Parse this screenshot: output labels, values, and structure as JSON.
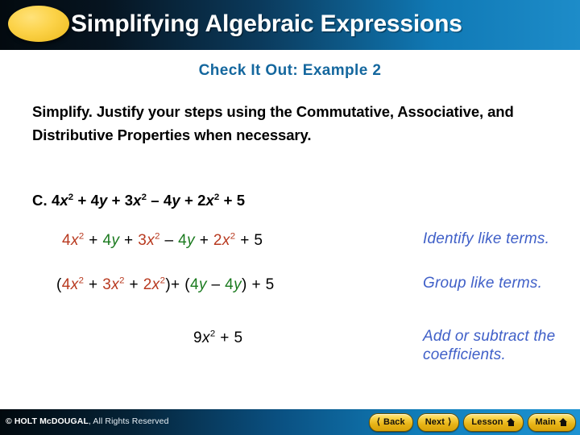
{
  "header": {
    "title": "Simplifying Algebraic Expressions",
    "badge_icon": "yellow-ellipse-icon",
    "gradient_left": "#030a0f",
    "gradient_right": "#1d8cc9"
  },
  "subtitle": {
    "text": "Check It Out: Example 2",
    "color": "#14679e"
  },
  "prompt": {
    "text": "Simplify. Justify your steps using the Commutative, Associative, and Distributive Properties when necessary."
  },
  "problem": {
    "label": "C.",
    "parts": [
      {
        "text": "4",
        "style": "plain"
      },
      {
        "text": "x",
        "style": "var"
      },
      {
        "text": "2",
        "style": "sup"
      },
      {
        "text": " + 4",
        "style": "plain"
      },
      {
        "text": "y",
        "style": "var"
      },
      {
        "text": " + 3",
        "style": "plain"
      },
      {
        "text": "x",
        "style": "var"
      },
      {
        "text": "2",
        "style": "sup"
      },
      {
        "text": " – 4",
        "style": "plain"
      },
      {
        "text": "y",
        "style": "var"
      },
      {
        "text": " + 2",
        "style": "plain"
      },
      {
        "text": "x",
        "style": "var"
      },
      {
        "text": "2",
        "style": "sup"
      },
      {
        "text": " + 5",
        "style": "plain"
      }
    ],
    "plain_text": "C. 4x2 + 4y + 3x2 – 4y + 2x2 + 5"
  },
  "colors": {
    "like_terms_x": "#b8391f",
    "like_terms_y": "#1a7a1e",
    "constant": "#000000",
    "annotation": "#4060c8"
  },
  "steps": [
    {
      "expression_plain": "4x2 + 4y + 3x2 – 4y + 2x2 + 5",
      "note": "Identify like terms."
    },
    {
      "expression_plain": "(4x2 + 3x2 + 2x2)+ (4y – 4y) + 5",
      "note": "Group like terms."
    },
    {
      "expression_plain": "9x2 + 5",
      "note": "Add or subtract the coefficients."
    }
  ],
  "footer": {
    "copyright_bold": "© HOLT McDOUGAL",
    "copyright_rest": ", All Rights Reserved",
    "buttons": [
      {
        "label": "Back",
        "icon": "chevron-left-icon",
        "icon_side": "left"
      },
      {
        "label": "Next",
        "icon": "chevron-right-icon",
        "icon_side": "right"
      },
      {
        "label": "Lesson",
        "icon": "home-icon",
        "icon_side": "right"
      },
      {
        "label": "Main",
        "icon": "home-icon",
        "icon_side": "right"
      }
    ]
  }
}
